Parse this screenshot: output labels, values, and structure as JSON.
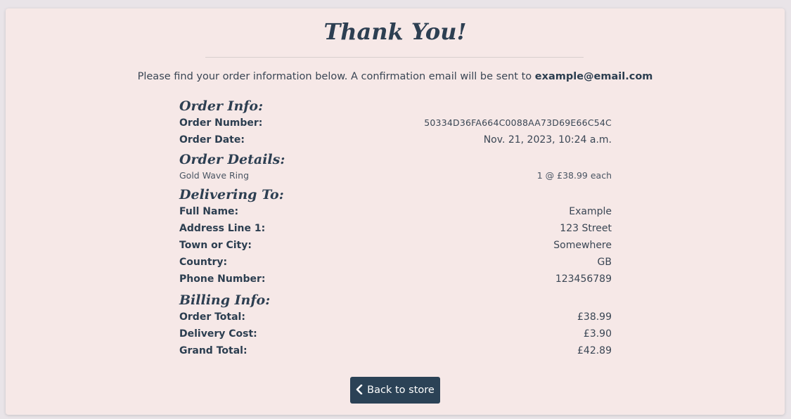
{
  "page": {
    "title": "Thank You!"
  },
  "intro": {
    "text": "Please find your order information below. A confirmation email will be sent to ",
    "email": "example@email.com"
  },
  "order_info": {
    "heading": "Order Info:",
    "number_label": "Order Number:",
    "number_value": "50334D36FA664C0088AA73D69E66C54C",
    "date_label": "Order Date:",
    "date_value": "Nov. 21, 2023, 10:24 a.m."
  },
  "order_details": {
    "heading": "Order Details:",
    "items": [
      {
        "name": "Gold Wave Ring",
        "qty_price": "1 @ £38.99 each"
      }
    ]
  },
  "delivering_to": {
    "heading": "Delivering To:",
    "full_name_label": "Full Name:",
    "full_name_value": "Example",
    "address1_label": "Address Line 1:",
    "address1_value": "123 Street",
    "town_label": "Town or City:",
    "town_value": "Somewhere",
    "country_label": "Country:",
    "country_value": "GB",
    "phone_label": "Phone Number:",
    "phone_value": "123456789"
  },
  "billing_info": {
    "heading": "Billing Info:",
    "order_total_label": "Order Total:",
    "order_total_value": "£38.99",
    "delivery_label": "Delivery Cost:",
    "delivery_value": "£3.90",
    "grand_total_label": "Grand Total:",
    "grand_total_value": "£42.89"
  },
  "actions": {
    "back_label": "Back to store",
    "back_icon": "chevron-left-icon"
  },
  "colors": {
    "card_bg": "#f6e8e7",
    "button_bg": "#2b4256",
    "text": "#2c3e50"
  }
}
